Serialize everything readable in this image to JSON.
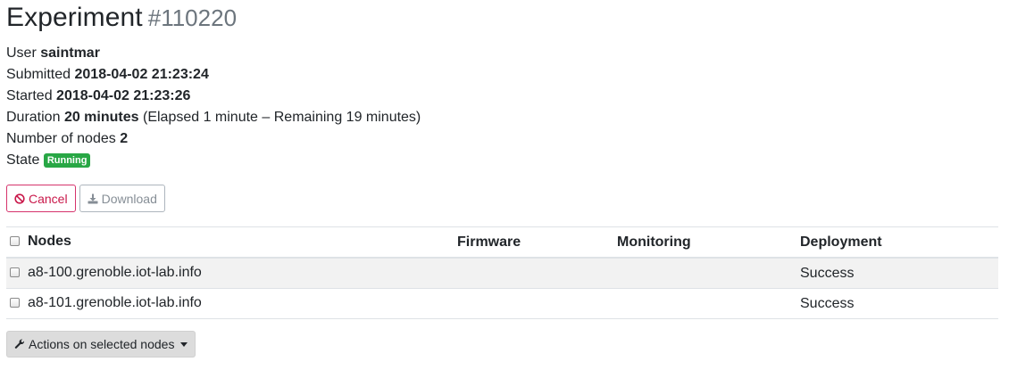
{
  "header": {
    "title": "Experiment",
    "id": "#110220"
  },
  "info": {
    "user_label": "User",
    "user_value": "saintmar",
    "submitted_label": "Submitted",
    "submitted_value": "2018-04-02 21:23:24",
    "started_label": "Started",
    "started_value": "2018-04-02 21:23:26",
    "duration_label": "Duration",
    "duration_value": "20 minutes",
    "duration_detail": "(Elapsed 1 minute – Remaining 19 minutes)",
    "nodes_label": "Number of nodes",
    "nodes_value": "2",
    "state_label": "State",
    "state_value": "Running"
  },
  "buttons": {
    "cancel": "Cancel",
    "download": "Download"
  },
  "table": {
    "headers": {
      "nodes": "Nodes",
      "firmware": "Firmware",
      "monitoring": "Monitoring",
      "deployment": "Deployment"
    },
    "rows": [
      {
        "node": "a8-100.grenoble.iot-lab.info",
        "firmware": "",
        "monitoring": "",
        "deployment": "Success"
      },
      {
        "node": "a8-101.grenoble.iot-lab.info",
        "firmware": "",
        "monitoring": "",
        "deployment": "Success"
      }
    ]
  },
  "actions": {
    "label": "Actions on selected nodes"
  },
  "colors": {
    "running_badge": "#28a745",
    "cancel": "#c9184a",
    "muted": "#6c757d"
  },
  "icons": {
    "cancel": "ban-icon",
    "download": "download-icon",
    "actions": "wrench-icon"
  }
}
